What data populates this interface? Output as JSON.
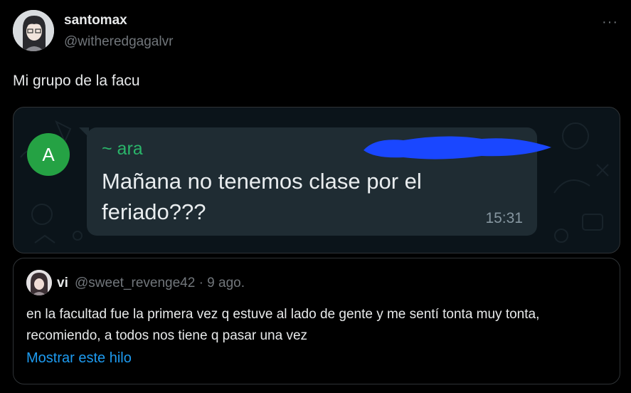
{
  "author": {
    "name": "santomax",
    "handle": "@witheredgagalvr",
    "more_label": "···"
  },
  "tweet": {
    "text": "Mi grupo de la facu"
  },
  "chat": {
    "avatar_letter": "A",
    "sender": "~ ara",
    "message": "Mañana no tenemos clase por el feriado???",
    "time": "15:31",
    "colors": {
      "bubble": "#1f2c33",
      "sender": "#2ab56a",
      "avatar": "#25a244",
      "redaction": "#1a47ff"
    }
  },
  "quoted": {
    "name": "vi",
    "handle_date": "@sweet_revenge42 · 9 ago.",
    "text": "en la facultad fue la primera vez q estuve al lado de gente y me sentí tonta muy tonta, recomiendo, a todos nos tiene q pasar una vez",
    "show_thread": "Mostrar este hilo"
  }
}
